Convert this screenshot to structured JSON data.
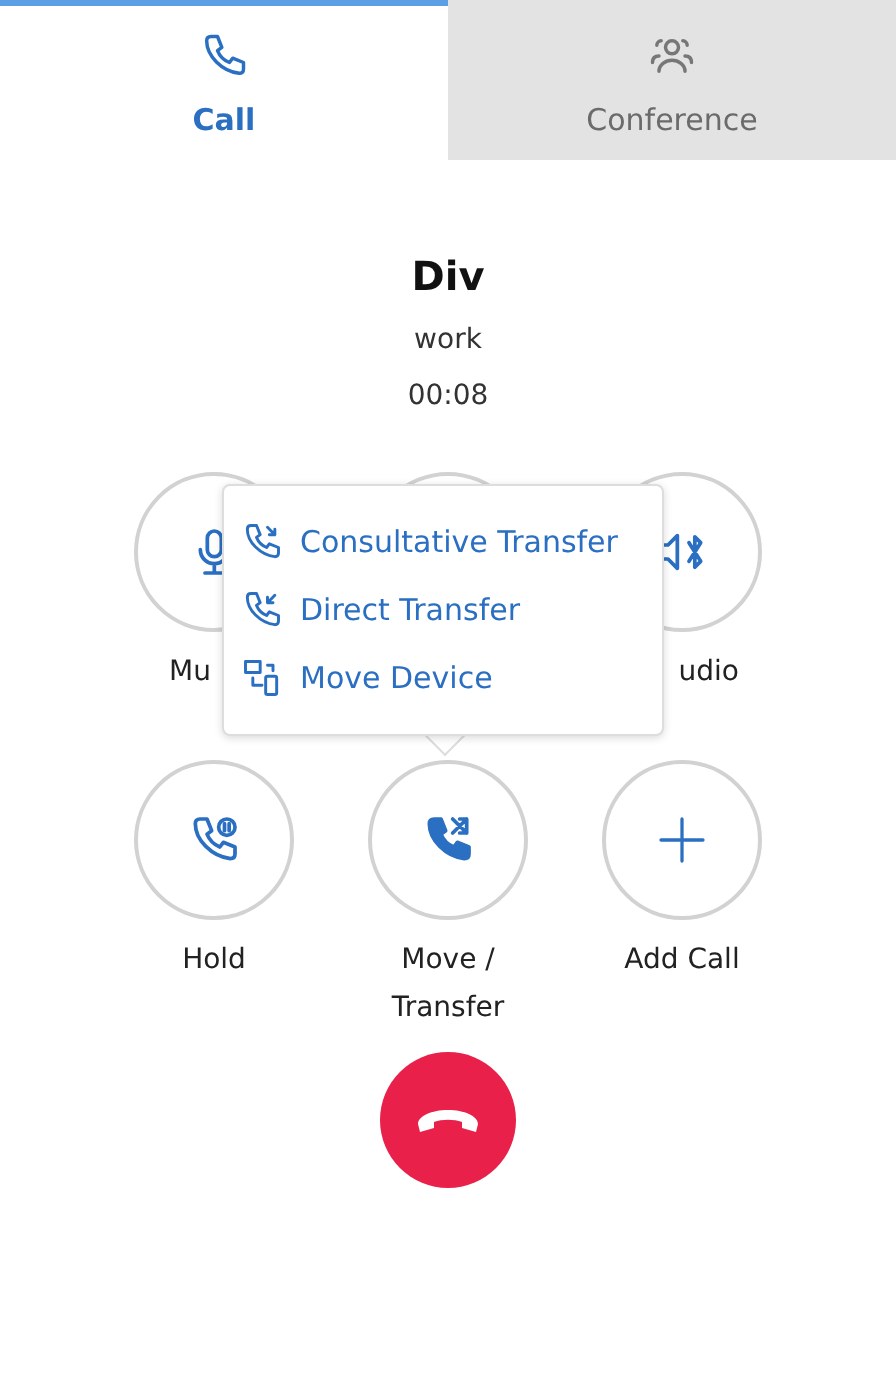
{
  "tabs": [
    {
      "label": "Call",
      "kind": "call",
      "selected": true
    },
    {
      "label": "Conference",
      "kind": "conference",
      "selected": false
    }
  ],
  "caller": {
    "name": "Div",
    "type": "work",
    "duration": "00:08"
  },
  "top_controls": [
    {
      "label": "Mu",
      "kind": "mute"
    },
    {
      "kind": "hidden"
    },
    {
      "label": "udio",
      "kind": "audio"
    }
  ],
  "transfer_menu": [
    {
      "label": "Consultative Transfer",
      "kind": "consult"
    },
    {
      "label": "Direct Transfer",
      "kind": "direct"
    },
    {
      "label": "Move Device",
      "kind": "move"
    }
  ],
  "bottom_controls": [
    {
      "label": "Hold",
      "kind": "hold"
    },
    {
      "label": "Move / Transfer",
      "kind": "transfer"
    },
    {
      "label": "Add Call",
      "kind": "add"
    }
  ]
}
